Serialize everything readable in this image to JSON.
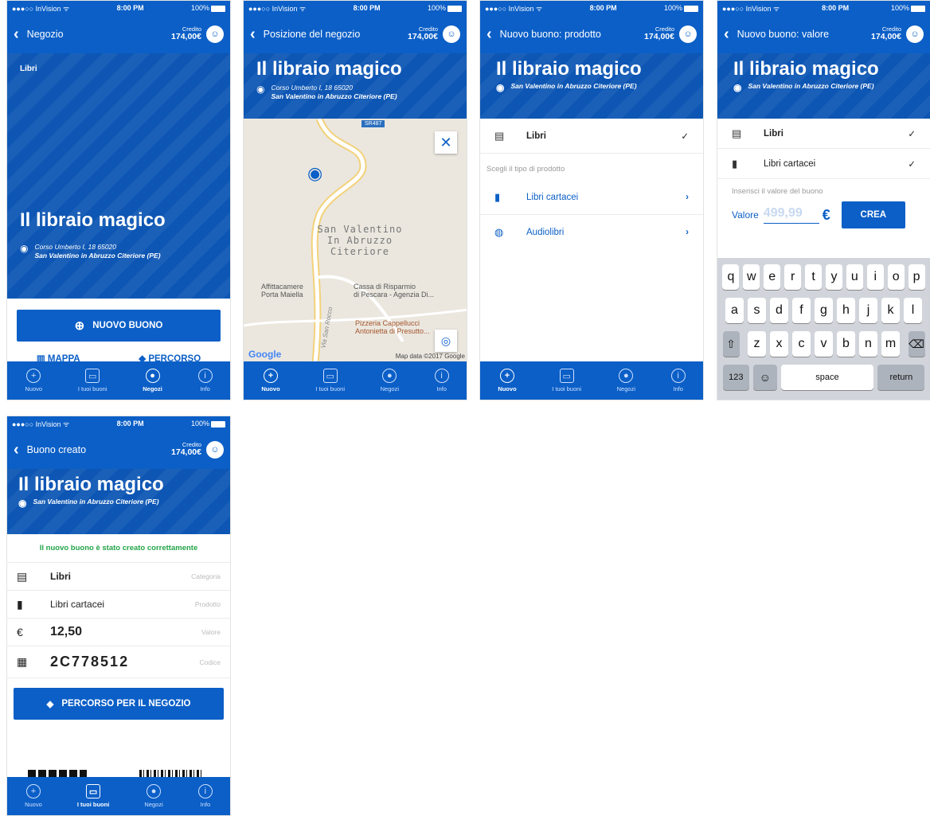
{
  "status": {
    "carrier": "●●●○○ InVision ᯤ",
    "time": "8:00 PM",
    "battery": "100%"
  },
  "credit": {
    "label": "Credito",
    "value": "174,00€"
  },
  "shop": {
    "name": "Il libraio magico",
    "address1": "Corso Umberto I, 18 65020",
    "address2": "San Valentino in Abruzzo Citeriore (PE)",
    "category": "Libri"
  },
  "tabs": [
    {
      "label": "Nuovo"
    },
    {
      "label": "I tuoi buoni"
    },
    {
      "label": "Negozi"
    },
    {
      "label": "Info"
    }
  ],
  "screen1": {
    "title": "Negozio",
    "new_button": "NUOVO BUONO",
    "map": "MAPPA",
    "route": "PERCORSO"
  },
  "screen2": {
    "title": "Posizione del negozio",
    "road": "SR487",
    "town": "San Valentino\nIn Abruzzo\nCiteriore",
    "poi1": "Affittacamere\nPorta Maiella",
    "poi2": "Cassa di Risparmio\ndi Pescara - Agenzia Di...",
    "poi3": "Pizzeria Cappellucci\nAntonietta di Presutto...",
    "street": "Via San Rocco",
    "google": "Google",
    "mapdata": "Map data ©2017 Google"
  },
  "screen3": {
    "title": "Nuovo buono: prodotto",
    "category": "Libri",
    "hint": "Scegli il tipo di prodotto",
    "items": [
      {
        "label": "Libri cartacei"
      },
      {
        "label": "Audiolibri"
      }
    ]
  },
  "screen4": {
    "title": "Nuovo buono: valore",
    "category": "Libri",
    "product": "Libri cartacei",
    "hint": "Inserisci il valore del buono",
    "value_label": "Valore",
    "value_placeholder": "499,99",
    "currency": "€",
    "create": "CREA",
    "keys": {
      "row1": [
        "q",
        "w",
        "e",
        "r",
        "t",
        "y",
        "u",
        "i",
        "o",
        "p"
      ],
      "row2": [
        "a",
        "s",
        "d",
        "f",
        "g",
        "h",
        "j",
        "k",
        "l"
      ],
      "row3": [
        "z",
        "x",
        "c",
        "v",
        "b",
        "n",
        "m"
      ],
      "shift": "⇧",
      "backspace": "⌫",
      "num": "123",
      "emoji": "☺",
      "space": "space",
      "return": "return"
    }
  },
  "screen5": {
    "title": "Buono creato",
    "success": "Il nuovo buono è stato creato correttamente",
    "category": "Libri",
    "category_label": "Categoria",
    "product": "Libri cartacei",
    "product_label": "Prodotto",
    "value": "12,50",
    "value_label": "Valore",
    "code": "2C778512",
    "code_label": "Codice",
    "route_button": "PERCORSO PER IL NEGOZIO"
  },
  "colors": {
    "primary": "#0b5fc7",
    "success": "#22a447"
  }
}
